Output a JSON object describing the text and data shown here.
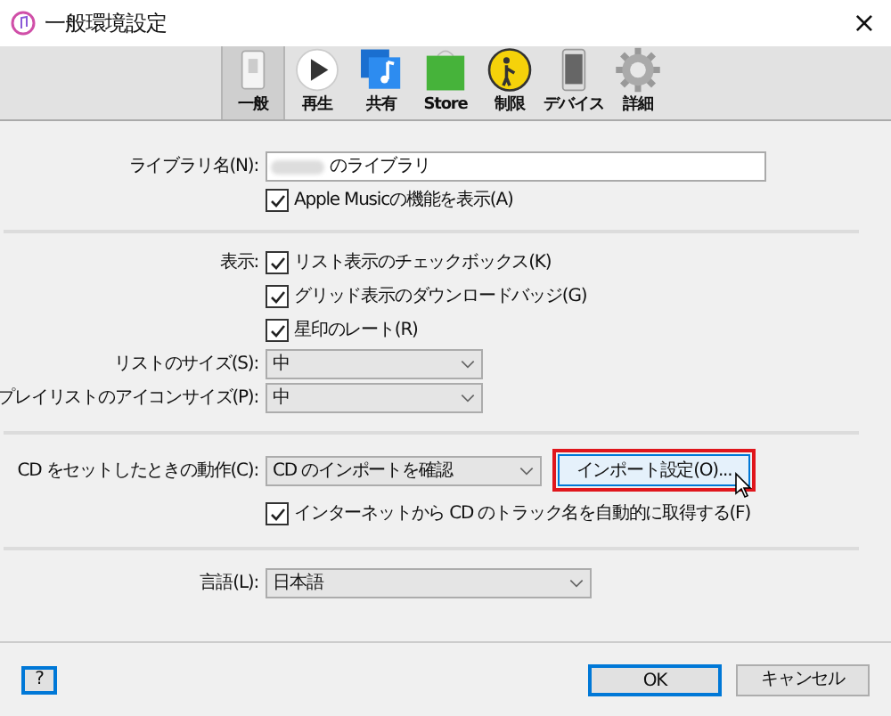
{
  "window": {
    "title": "一般環境設定",
    "close": "×"
  },
  "tabs": [
    {
      "label": "一般",
      "selected": true
    },
    {
      "label": "再生",
      "selected": false
    },
    {
      "label": "共有",
      "selected": false
    },
    {
      "label": "Store",
      "selected": false
    },
    {
      "label": "制限",
      "selected": false
    },
    {
      "label": "デバイス",
      "selected": false
    },
    {
      "label": "詳細",
      "selected": false
    }
  ],
  "library": {
    "label": "ライブラリ名(N):",
    "value": "のライブラリ",
    "apple_music": {
      "label": "Apple Musicの機能を表示(A)",
      "checked": true
    }
  },
  "display": {
    "label": "表示:",
    "options": [
      {
        "label": "リスト表示のチェックボックス(K)",
        "checked": true
      },
      {
        "label": "グリッド表示のダウンロードバッジ(G)",
        "checked": true
      },
      {
        "label": "星印のレート(R)",
        "checked": true
      }
    ]
  },
  "list_size": {
    "label": "リストのサイズ(S):",
    "value": "中"
  },
  "playlist_icon_size": {
    "label": "プレイリストのアイコンサイズ(P):",
    "value": "中"
  },
  "cd": {
    "label": "CD をセットしたときの動作(C):",
    "value": "CD のインポートを確認",
    "import_button": {
      "label": "インポート設定(O)...",
      "highlighted": true
    },
    "auto_names": {
      "label": "インターネットから CD のトラック名を自動的に取得する(F)",
      "checked": true
    }
  },
  "language": {
    "label": "言語(L):",
    "value": "日本語"
  },
  "buttons": {
    "help": "?",
    "ok": "OK",
    "cancel": "キャンセル"
  }
}
